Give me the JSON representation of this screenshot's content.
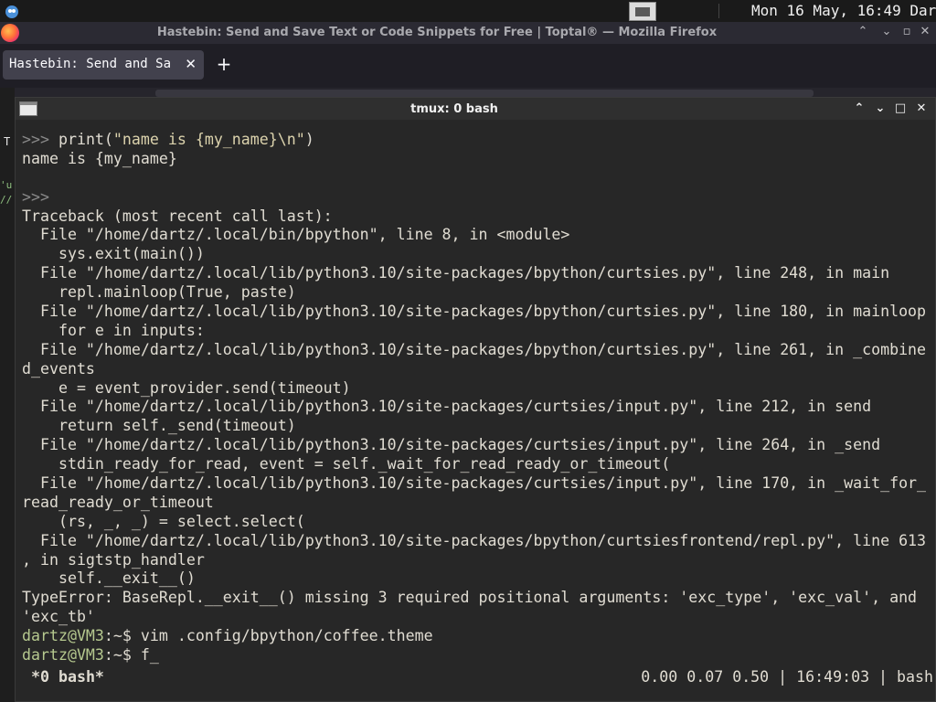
{
  "top_panel": {
    "clock": "Mon 16 May, 16:49",
    "user": "Dartz"
  },
  "firefox": {
    "window_title": "Hastebin: Send and Save Text or Code Snippets for Free | Toptal® — Mozilla Firefox",
    "tab_label": "Hastebin: Send and Sa",
    "tab_close": "✕",
    "new_tab": "+",
    "btn_min": "⌃",
    "btn_restore": "⌄",
    "btn_max": "▫",
    "btn_close": "✕"
  },
  "behind": {
    "t": "T",
    "u": "'u",
    "slash": "//"
  },
  "terminal": {
    "title": "tmux: 0 bash",
    "btn_up": "⌃",
    "btn_down": "⌄",
    "btn_max": "□",
    "btn_close": "✕",
    "lines": [
      [
        {
          "t": ">>> ",
          "c": "c-prompt"
        },
        {
          "t": "print(",
          "c": "c-plain"
        },
        {
          "t": "\"name is {my_name}\\n\"",
          "c": "c-str"
        },
        {
          "t": ")",
          "c": "c-plain"
        }
      ],
      [
        {
          "t": "name is {my_name}",
          "c": "c-plain"
        }
      ],
      [
        {
          "t": "",
          "c": "c-plain"
        }
      ],
      [
        {
          "t": ">>>",
          "c": "c-prompt"
        }
      ],
      [
        {
          "t": "Traceback (most recent call last):",
          "c": "c-plain"
        }
      ],
      [
        {
          "t": "  File \"/home/dartz/.local/bin/bpython\", line 8, in <module>",
          "c": "c-plain"
        }
      ],
      [
        {
          "t": "    sys.exit(main())",
          "c": "c-plain"
        }
      ],
      [
        {
          "t": "  File \"/home/dartz/.local/lib/python3.10/site-packages/bpython/curtsies.py\", line 248, in main",
          "c": "c-plain"
        }
      ],
      [
        {
          "t": "    repl.mainloop(True, paste)",
          "c": "c-plain"
        }
      ],
      [
        {
          "t": "  File \"/home/dartz/.local/lib/python3.10/site-packages/bpython/curtsies.py\", line 180, in mainloop",
          "c": "c-plain"
        }
      ],
      [
        {
          "t": "    for e in inputs:",
          "c": "c-plain"
        }
      ],
      [
        {
          "t": "  File \"/home/dartz/.local/lib/python3.10/site-packages/bpython/curtsies.py\", line 261, in _combine",
          "c": "c-plain"
        }
      ],
      [
        {
          "t": "d_events",
          "c": "c-plain"
        }
      ],
      [
        {
          "t": "    e = event_provider.send(timeout)",
          "c": "c-plain"
        }
      ],
      [
        {
          "t": "  File \"/home/dartz/.local/lib/python3.10/site-packages/curtsies/input.py\", line 212, in send",
          "c": "c-plain"
        }
      ],
      [
        {
          "t": "    return self._send(timeout)",
          "c": "c-plain"
        }
      ],
      [
        {
          "t": "  File \"/home/dartz/.local/lib/python3.10/site-packages/curtsies/input.py\", line 264, in _send",
          "c": "c-plain"
        }
      ],
      [
        {
          "t": "    stdin_ready_for_read, event = self._wait_for_read_ready_or_timeout(",
          "c": "c-plain"
        }
      ],
      [
        {
          "t": "  File \"/home/dartz/.local/lib/python3.10/site-packages/curtsies/input.py\", line 170, in _wait_for_",
          "c": "c-plain"
        }
      ],
      [
        {
          "t": "read_ready_or_timeout",
          "c": "c-plain"
        }
      ],
      [
        {
          "t": "    (rs, _, _) = select.select(",
          "c": "c-plain"
        }
      ],
      [
        {
          "t": "  File \"/home/dartz/.local/lib/python3.10/site-packages/bpython/curtsiesfrontend/repl.py\", line 613",
          "c": "c-plain"
        }
      ],
      [
        {
          "t": ", in sigtstp_handler",
          "c": "c-plain"
        }
      ],
      [
        {
          "t": "    self.__exit__()",
          "c": "c-plain"
        }
      ],
      [
        {
          "t": "TypeError: BaseRepl.__exit__() missing 3 required positional arguments: 'exc_type', 'exc_val', and",
          "c": "c-plain"
        }
      ],
      [
        {
          "t": "'exc_tb'",
          "c": "c-plain"
        }
      ],
      [
        {
          "t": "dartz@VM3",
          "c": "c-green"
        },
        {
          "t": ":~$ vim .config/bpython/coffee.theme",
          "c": "c-plain"
        }
      ],
      [
        {
          "t": "dartz@VM3",
          "c": "c-green"
        },
        {
          "t": ":~$ f_",
          "c": "c-plain"
        }
      ]
    ],
    "status_window": "*0 bash*",
    "status_right": "0.00 0.07 0.50 | 16:49:03 | bash"
  }
}
